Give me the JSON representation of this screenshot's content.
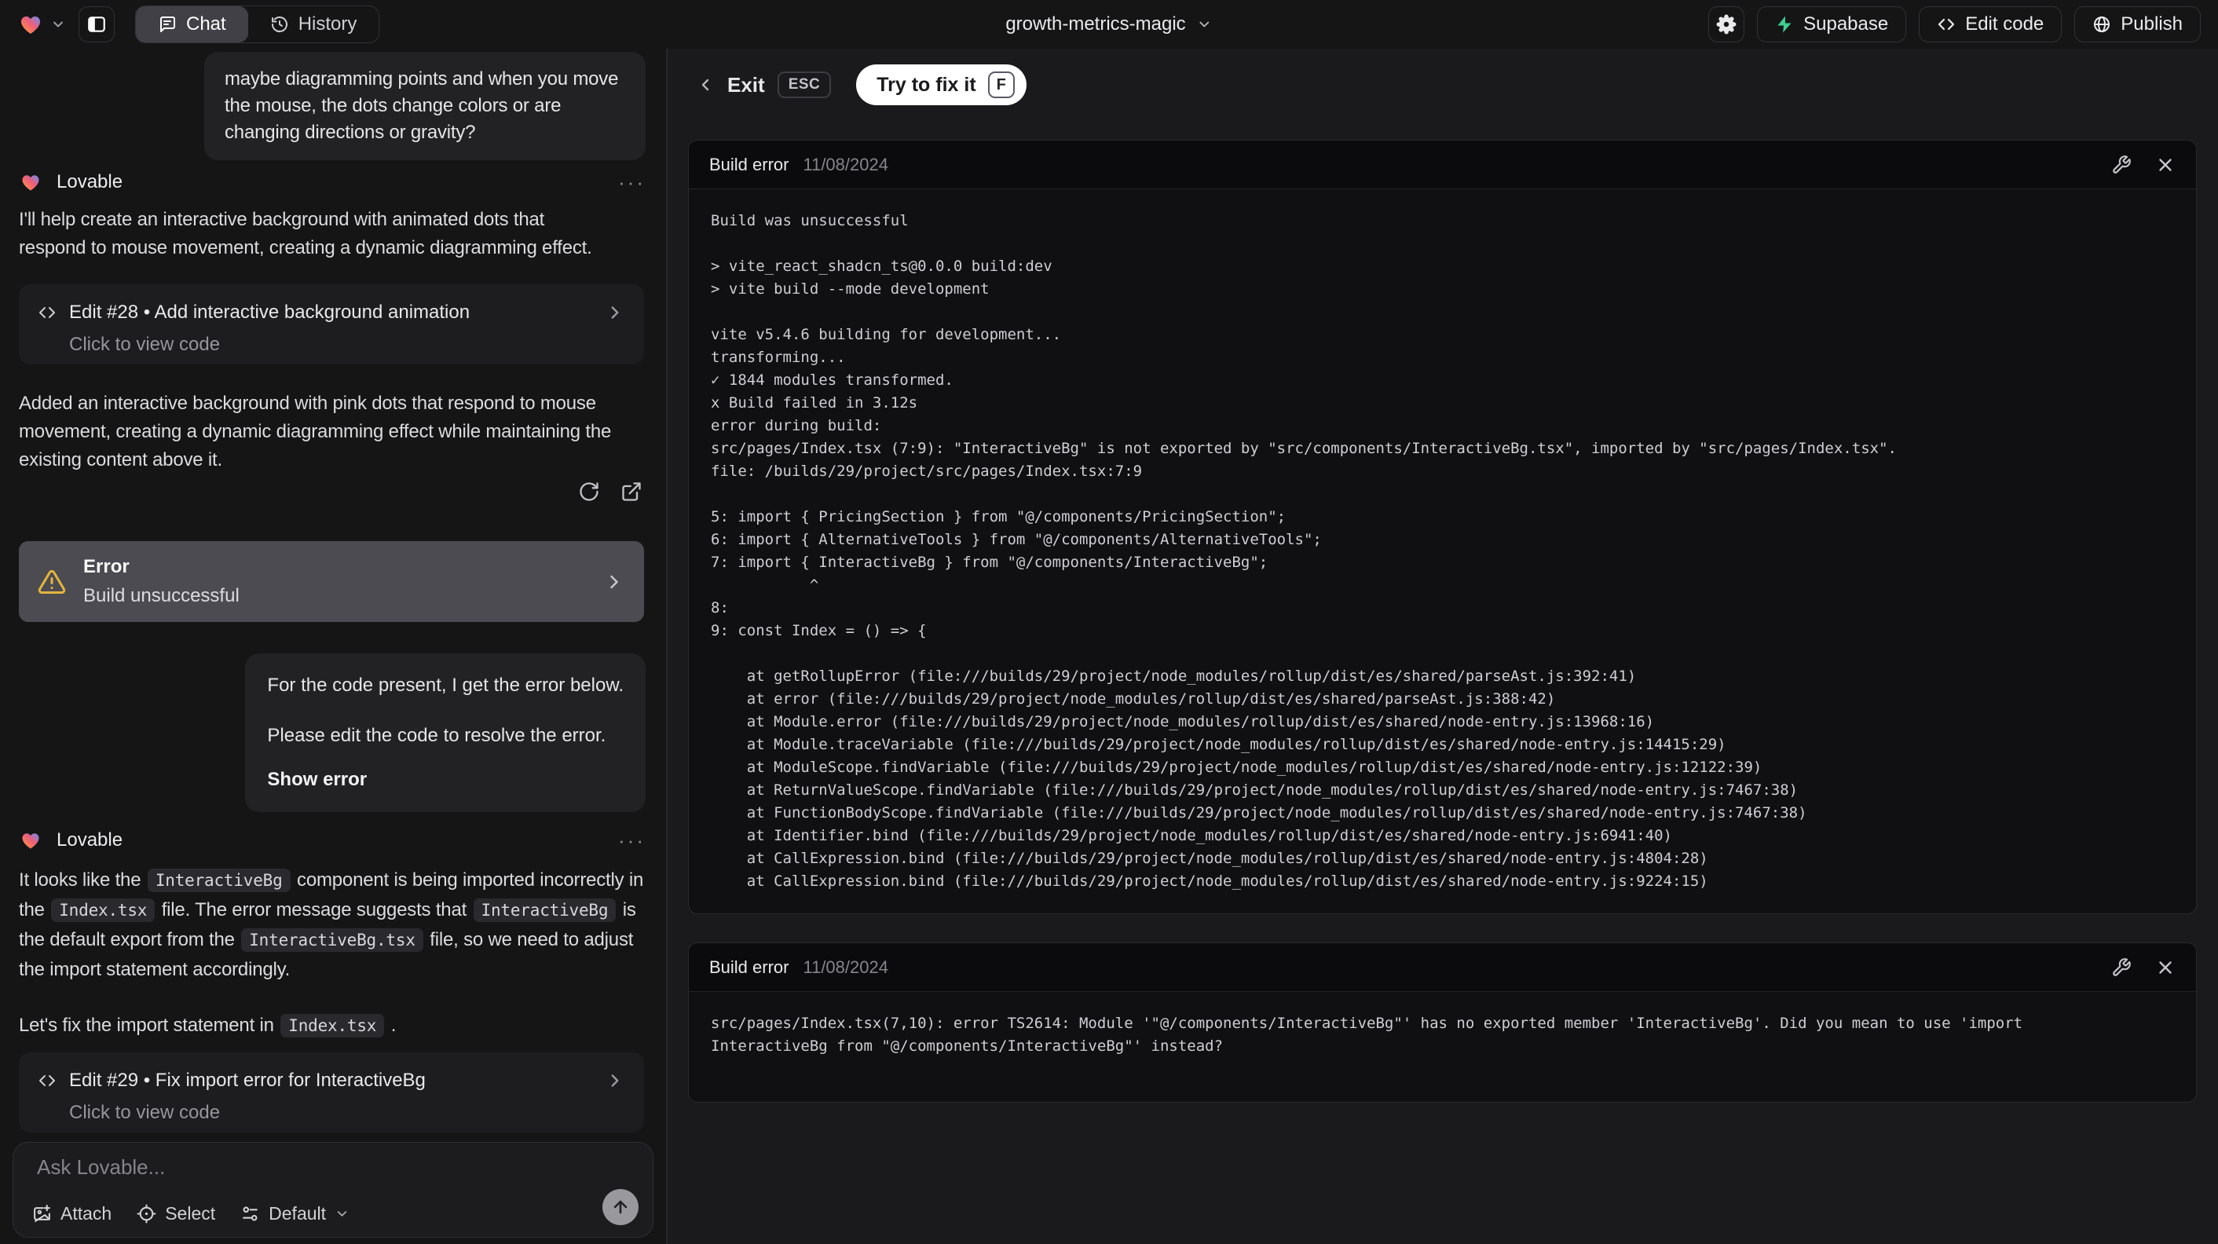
{
  "topbar": {
    "project_name": "growth-metrics-magic",
    "tabs": [
      {
        "label": "Chat"
      },
      {
        "label": "History"
      }
    ],
    "supabase_label": "Supabase",
    "edit_code_label": "Edit code",
    "publish_label": "Publish"
  },
  "chat": {
    "assistant_name": "Lovable",
    "more_label": "···",
    "user_message_1": "maybe diagramming points and when you move the mouse, the dots change colors or are changing directions or gravity?",
    "assistant_message_1": "I'll help create an interactive background with animated dots that respond to mouse movement, creating a dynamic diagramming effect.",
    "edit_card_1": {
      "title": "Edit #28 • Add interactive background animation",
      "subtitle": "Click to view code"
    },
    "assistant_message_2": "Added an interactive background with pink dots that respond to mouse movement, creating a dynamic diagramming effect while maintaining the existing content above it.",
    "error_card": {
      "title": "Error",
      "subtitle": "Build unsuccessful"
    },
    "user_message_2": {
      "line1": "For the code present, I get the error below.",
      "line2": "Please edit the code to resolve the error.",
      "link": "Show error"
    },
    "assistant_message_3_segments": [
      {
        "text": "It looks like the "
      },
      {
        "text": "InteractiveBg",
        "code": true
      },
      {
        "text": " component is being imported incorrectly in the "
      },
      {
        "text": "Index.tsx",
        "code": true
      },
      {
        "text": " file. The error message suggests that "
      },
      {
        "text": "InteractiveBg",
        "code": true
      },
      {
        "text": " is the default export from the "
      },
      {
        "text": "InteractiveBg.tsx",
        "code": true
      },
      {
        "text": " file, so we need to adjust the import statement accordingly."
      }
    ],
    "assistant_message_4_segments": [
      {
        "text": "Let's fix the import statement in "
      },
      {
        "text": "Index.tsx",
        "code": true
      },
      {
        "text": " ."
      }
    ],
    "edit_card_2": {
      "title": "Edit #29 • Fix import error for InteractiveBg",
      "subtitle": "Click to view code"
    },
    "composer": {
      "placeholder": "Ask Lovable...",
      "attach_label": "Attach",
      "select_label": "Select",
      "mode_label": "Default"
    }
  },
  "error_panel": {
    "exit_label": "Exit",
    "esc_key": "ESC",
    "fix_button_label": "Try to fix it",
    "fix_key": "F",
    "cards": [
      {
        "title": "Build error",
        "date": "11/08/2024",
        "lines": [
          "Build was unsuccessful",
          "",
          "> vite_react_shadcn_ts@0.0.0 build:dev",
          "> vite build --mode development",
          "",
          "vite v5.4.6 building for development...",
          "transforming...",
          "✓ 1844 modules transformed.",
          "x Build failed in 3.12s",
          "error during build:",
          "src/pages/Index.tsx (7:9): \"InteractiveBg\" is not exported by \"src/components/InteractiveBg.tsx\", imported by \"src/pages/Index.tsx\".",
          "file: /builds/29/project/src/pages/Index.tsx:7:9",
          "",
          "5: import { PricingSection } from \"@/components/PricingSection\";",
          "6: import { AlternativeTools } from \"@/components/AlternativeTools\";",
          "7: import { InteractiveBg } from \"@/components/InteractiveBg\";",
          "           ^",
          "8:",
          "9: const Index = () => {",
          "",
          "    at getRollupError (file:///builds/29/project/node_modules/rollup/dist/es/shared/parseAst.js:392:41)",
          "    at error (file:///builds/29/project/node_modules/rollup/dist/es/shared/parseAst.js:388:42)",
          "    at Module.error (file:///builds/29/project/node_modules/rollup/dist/es/shared/node-entry.js:13968:16)",
          "    at Module.traceVariable (file:///builds/29/project/node_modules/rollup/dist/es/shared/node-entry.js:14415:29)",
          "    at ModuleScope.findVariable (file:///builds/29/project/node_modules/rollup/dist/es/shared/node-entry.js:12122:39)",
          "    at ReturnValueScope.findVariable (file:///builds/29/project/node_modules/rollup/dist/es/shared/node-entry.js:7467:38)",
          "    at FunctionBodyScope.findVariable (file:///builds/29/project/node_modules/rollup/dist/es/shared/node-entry.js:7467:38)",
          "    at Identifier.bind (file:///builds/29/project/node_modules/rollup/dist/es/shared/node-entry.js:6941:40)",
          "    at CallExpression.bind (file:///builds/29/project/node_modules/rollup/dist/es/shared/node-entry.js:4804:28)",
          "    at CallExpression.bind (file:///builds/29/project/node_modules/rollup/dist/es/shared/node-entry.js:9224:15)"
        ]
      },
      {
        "title": "Build error",
        "date": "11/08/2024",
        "lines": [
          "src/pages/Index.tsx(7,10): error TS2614: Module '\"@/components/InteractiveBg\"' has no exported member 'InteractiveBg'. Did you mean to use 'import",
          "InteractiveBg from \"@/components/InteractiveBg\"' instead?"
        ]
      }
    ]
  },
  "colors": {
    "supabase_green": "#3ecf8e",
    "warning_amber": "#e2b53e",
    "primary_button_bg": "#ffffff",
    "error_card_bg": "#4b4b51",
    "logo_gradient": [
      "#ff9d3c",
      "#ef5e78",
      "#6e8df6"
    ]
  }
}
